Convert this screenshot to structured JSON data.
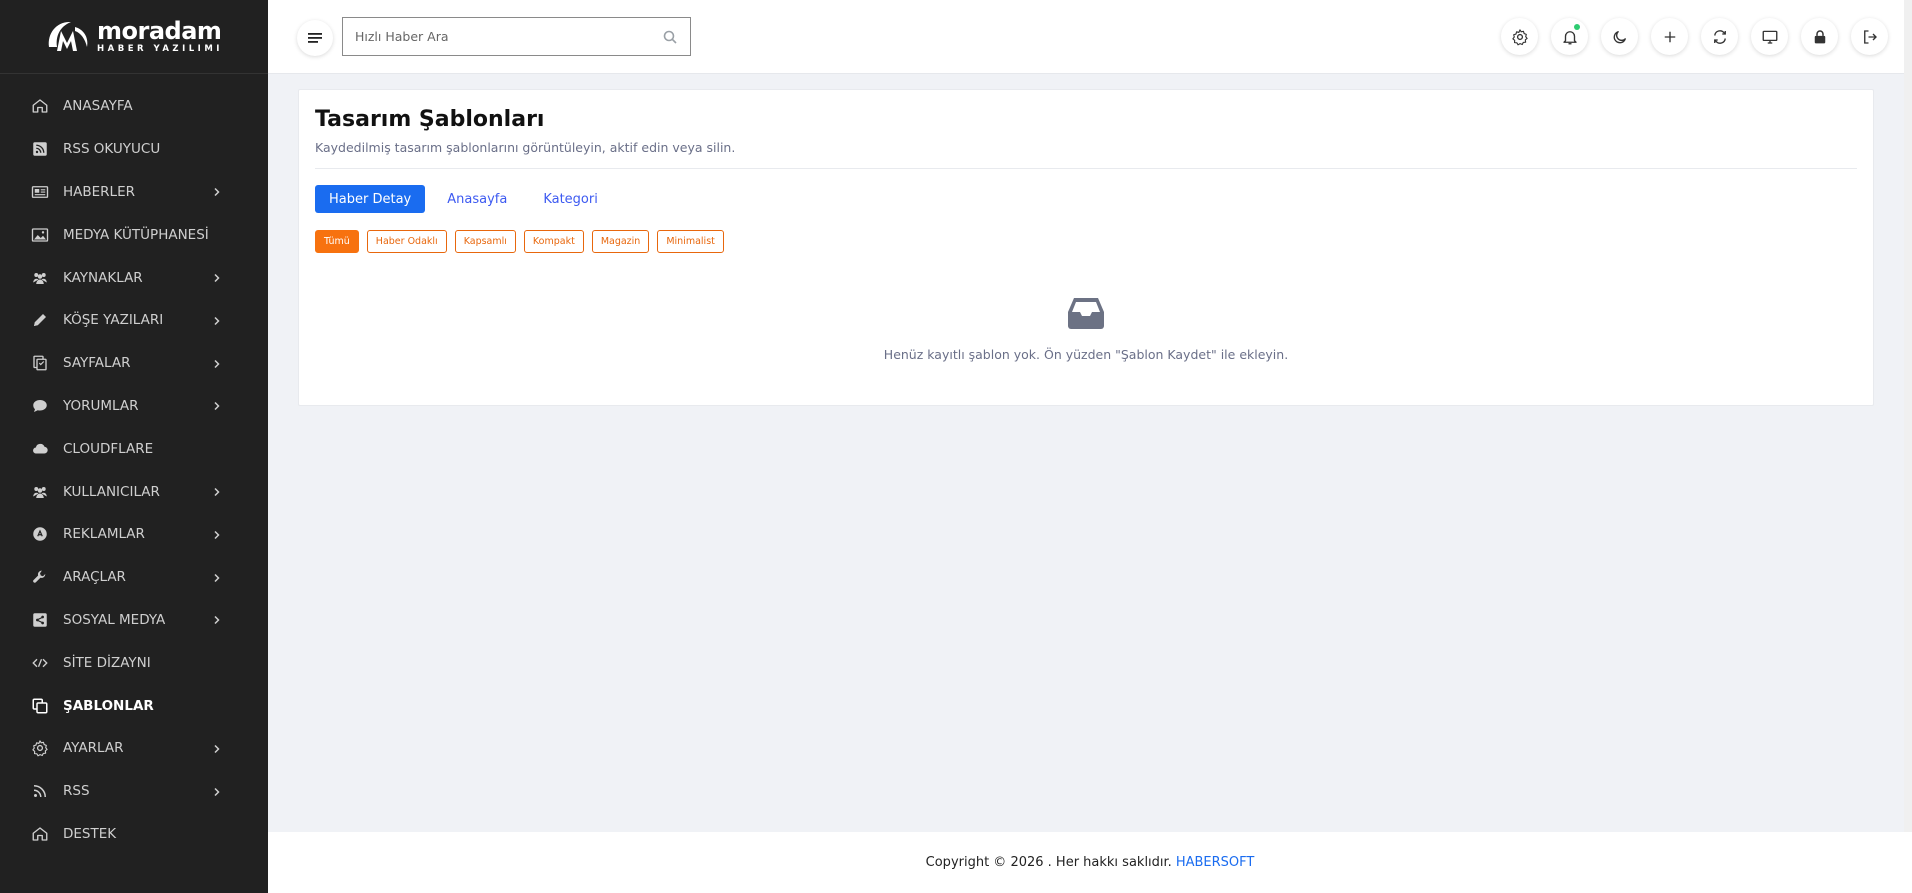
{
  "brand": {
    "name": "moradam",
    "tagline": "HABER YAZILIMI"
  },
  "sidebar": {
    "items": [
      {
        "label": "ANASAYFA",
        "icon": "home-icon",
        "has_submenu": false,
        "active": false
      },
      {
        "label": "RSS OKUYUCU",
        "icon": "rss-square-icon",
        "has_submenu": false,
        "active": false
      },
      {
        "label": "HABERLER",
        "icon": "newspaper-icon",
        "has_submenu": true,
        "active": false
      },
      {
        "label": "MEDYA KÜTÜPHANESİ",
        "icon": "image-icon",
        "has_submenu": false,
        "active": false
      },
      {
        "label": "KAYNAKLAR",
        "icon": "users-icon",
        "has_submenu": true,
        "active": false
      },
      {
        "label": "KÖŞE YAZILARI",
        "icon": "pencil-icon",
        "has_submenu": true,
        "active": false
      },
      {
        "label": "SAYFALAR",
        "icon": "pages-icon",
        "has_submenu": true,
        "active": false
      },
      {
        "label": "YORUMLAR",
        "icon": "comment-icon",
        "has_submenu": true,
        "active": false
      },
      {
        "label": "CLOUDFLARE",
        "icon": "cloud-icon",
        "has_submenu": false,
        "active": false
      },
      {
        "label": "KULLANICILAR",
        "icon": "users-icon",
        "has_submenu": true,
        "active": false
      },
      {
        "label": "REKLAMLAR",
        "icon": "ad-icon",
        "has_submenu": true,
        "active": false
      },
      {
        "label": "ARAÇLAR",
        "icon": "wrench-icon",
        "has_submenu": true,
        "active": false
      },
      {
        "label": "SOSYAL MEDYA",
        "icon": "share-icon",
        "has_submenu": true,
        "active": false
      },
      {
        "label": "SİTE DİZAYNI",
        "icon": "code-icon",
        "has_submenu": false,
        "active": false
      },
      {
        "label": "ŞABLONLAR",
        "icon": "copy-icon",
        "has_submenu": false,
        "active": true
      },
      {
        "label": "AYARLAR",
        "icon": "gear-icon",
        "has_submenu": true,
        "active": false
      },
      {
        "label": "RSS",
        "icon": "rss-icon",
        "has_submenu": true,
        "active": false
      },
      {
        "label": "DESTEK",
        "icon": "home-icon",
        "has_submenu": false,
        "active": false
      }
    ]
  },
  "topbar": {
    "search_placeholder": "Hızlı Haber Ara",
    "icons": [
      "gear-icon",
      "bell-icon",
      "moon-icon",
      "plus-icon",
      "sync-icon",
      "desktop-icon",
      "lock-icon",
      "logout-icon"
    ]
  },
  "page": {
    "title": "Tasarım Şablonları",
    "subtitle": "Kaydedilmiş tasarım şablonlarını görüntüleyin, aktif edin veya silin.",
    "tabs": [
      {
        "label": "Haber Detay",
        "active": true
      },
      {
        "label": "Anasayfa",
        "active": false
      },
      {
        "label": "Kategori",
        "active": false
      }
    ],
    "filters": [
      {
        "label": "Tümü",
        "active": true
      },
      {
        "label": "Haber Odaklı",
        "active": false
      },
      {
        "label": "Kapsamlı",
        "active": false
      },
      {
        "label": "Kompakt",
        "active": false
      },
      {
        "label": "Magazin",
        "active": false
      },
      {
        "label": "Minimalist",
        "active": false
      }
    ],
    "empty_text": "Henüz kayıtlı şablon yok. Ön yüzden \"Şablon Kaydet\" ile ekleyin."
  },
  "footer": {
    "text": "Copyright © 2026 . Her hakkı saklıdır.",
    "brand_link": "HABERSOFT"
  },
  "colors": {
    "sidebar_bg": "#212121",
    "primary": "#1a6cf0",
    "accent_orange": "#f7720f",
    "notification_dot": "#2ecc71"
  }
}
